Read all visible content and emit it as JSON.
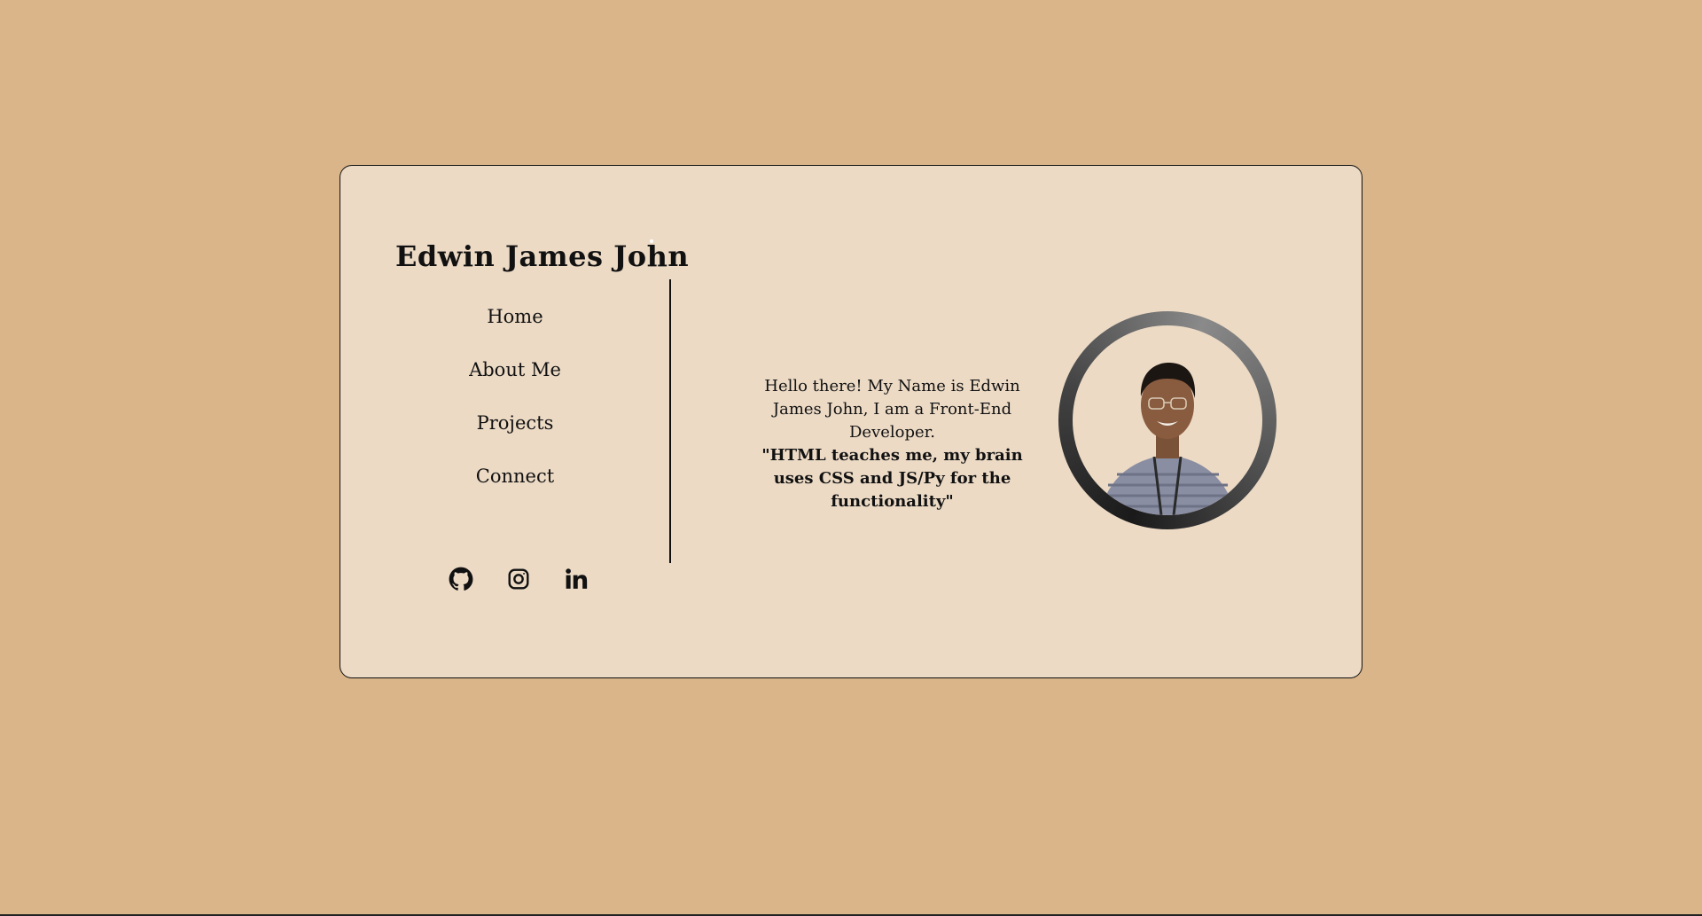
{
  "brand": {
    "name": "Edwin James John"
  },
  "nav": {
    "items": [
      {
        "label": "Home"
      },
      {
        "label": "About Me"
      },
      {
        "label": "Projects"
      },
      {
        "label": "Connect"
      }
    ]
  },
  "socials": [
    {
      "icon": "github-icon"
    },
    {
      "icon": "instagram-icon"
    },
    {
      "icon": "linkedin-icon"
    }
  ],
  "intro": {
    "text": "Hello there! My Name is Edwin James John, I am a Front-End Developer.",
    "quote": "\"HTML teaches me, my brain uses CSS and JS/Py for the functionality\""
  },
  "colors": {
    "background": "#d9b589",
    "card": "#ecdac5",
    "text": "#111111"
  }
}
